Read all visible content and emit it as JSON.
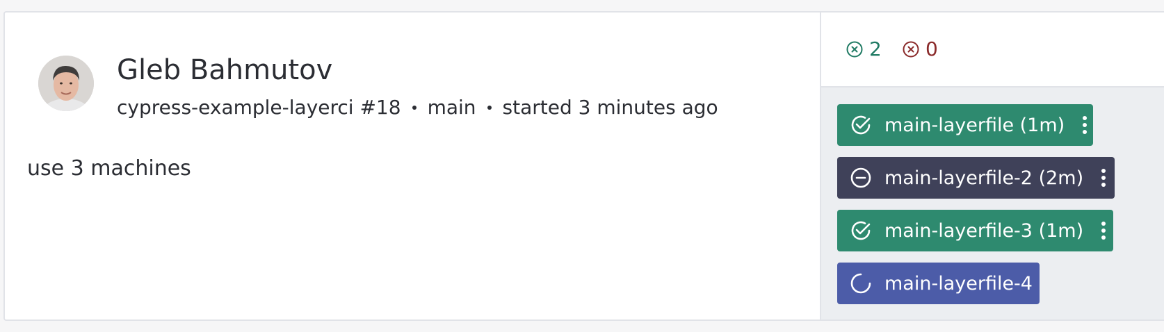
{
  "run": {
    "author": "Gleb Bahmutov",
    "project_run": "cypress-example-layerci #18",
    "branch": "main",
    "started": "started 3 minutes ago",
    "message": "use 3 machines"
  },
  "counts": {
    "passed": "2",
    "failed": "0",
    "passed_icon": "circle-x-icon",
    "failed_icon": "circle-x-icon",
    "passed_color": "#1f7a63",
    "failed_color": "#8a2a2a"
  },
  "groups": [
    {
      "label": "main-layerfile (1m)",
      "status": "passed",
      "icon": "check-circle-icon",
      "color": "#2e8a6f"
    },
    {
      "label": "main-layerfile-2 (2m)",
      "status": "cancelled",
      "icon": "minus-circle-icon",
      "color": "#3f4159"
    },
    {
      "label": "main-layerfile-3 (1m)",
      "status": "passed",
      "icon": "check-circle-icon",
      "color": "#2e8a6f"
    },
    {
      "label": "main-layerfile-4",
      "status": "running",
      "icon": "spinner-icon",
      "color": "#4c5ca8"
    }
  ]
}
